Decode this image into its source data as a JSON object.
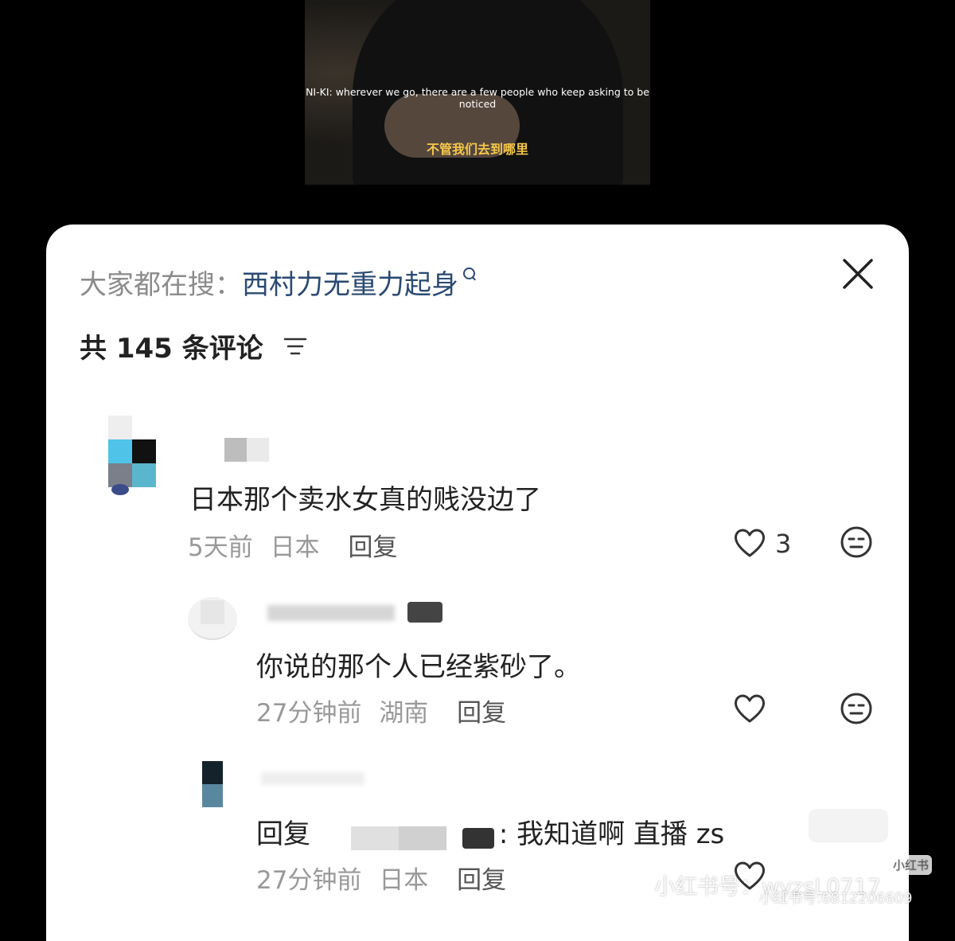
{
  "video": {
    "caption_en": "NI-KI: wherever we go, there are a few people who keep asking to be noticed",
    "caption_zh": "不管我们去到哪里"
  },
  "search_banner": {
    "prefix": "大家都在搜：",
    "term": "西村力无重力起身"
  },
  "comment_count_label": "共 145 条评论",
  "comments": [
    {
      "text": "日本那个卖水女真的贱没边了",
      "time": "5天前",
      "location": "日本",
      "reply_label": "回复",
      "likes": "3"
    },
    {
      "text": "你说的那个人已经紫砂了。",
      "time": "27分钟前",
      "location": "湖南",
      "reply_label": "回复"
    },
    {
      "text_prefix": "回复",
      "text_suffix": ": 我知道啊 直播 zs",
      "time": "27分钟前",
      "location": "日本",
      "reply_label": "回复"
    }
  ],
  "watermarks": {
    "main": "小红书号：wyzsL0717",
    "logo_text": "小红书",
    "secondary": "小红书号:6812206609"
  },
  "colors": {
    "search_term": "#2a4a72",
    "text": "#222222",
    "meta": "#999999"
  },
  "icons": [
    "search-icon",
    "close-icon",
    "sort-icon",
    "heart-icon",
    "emoji-icon"
  ]
}
